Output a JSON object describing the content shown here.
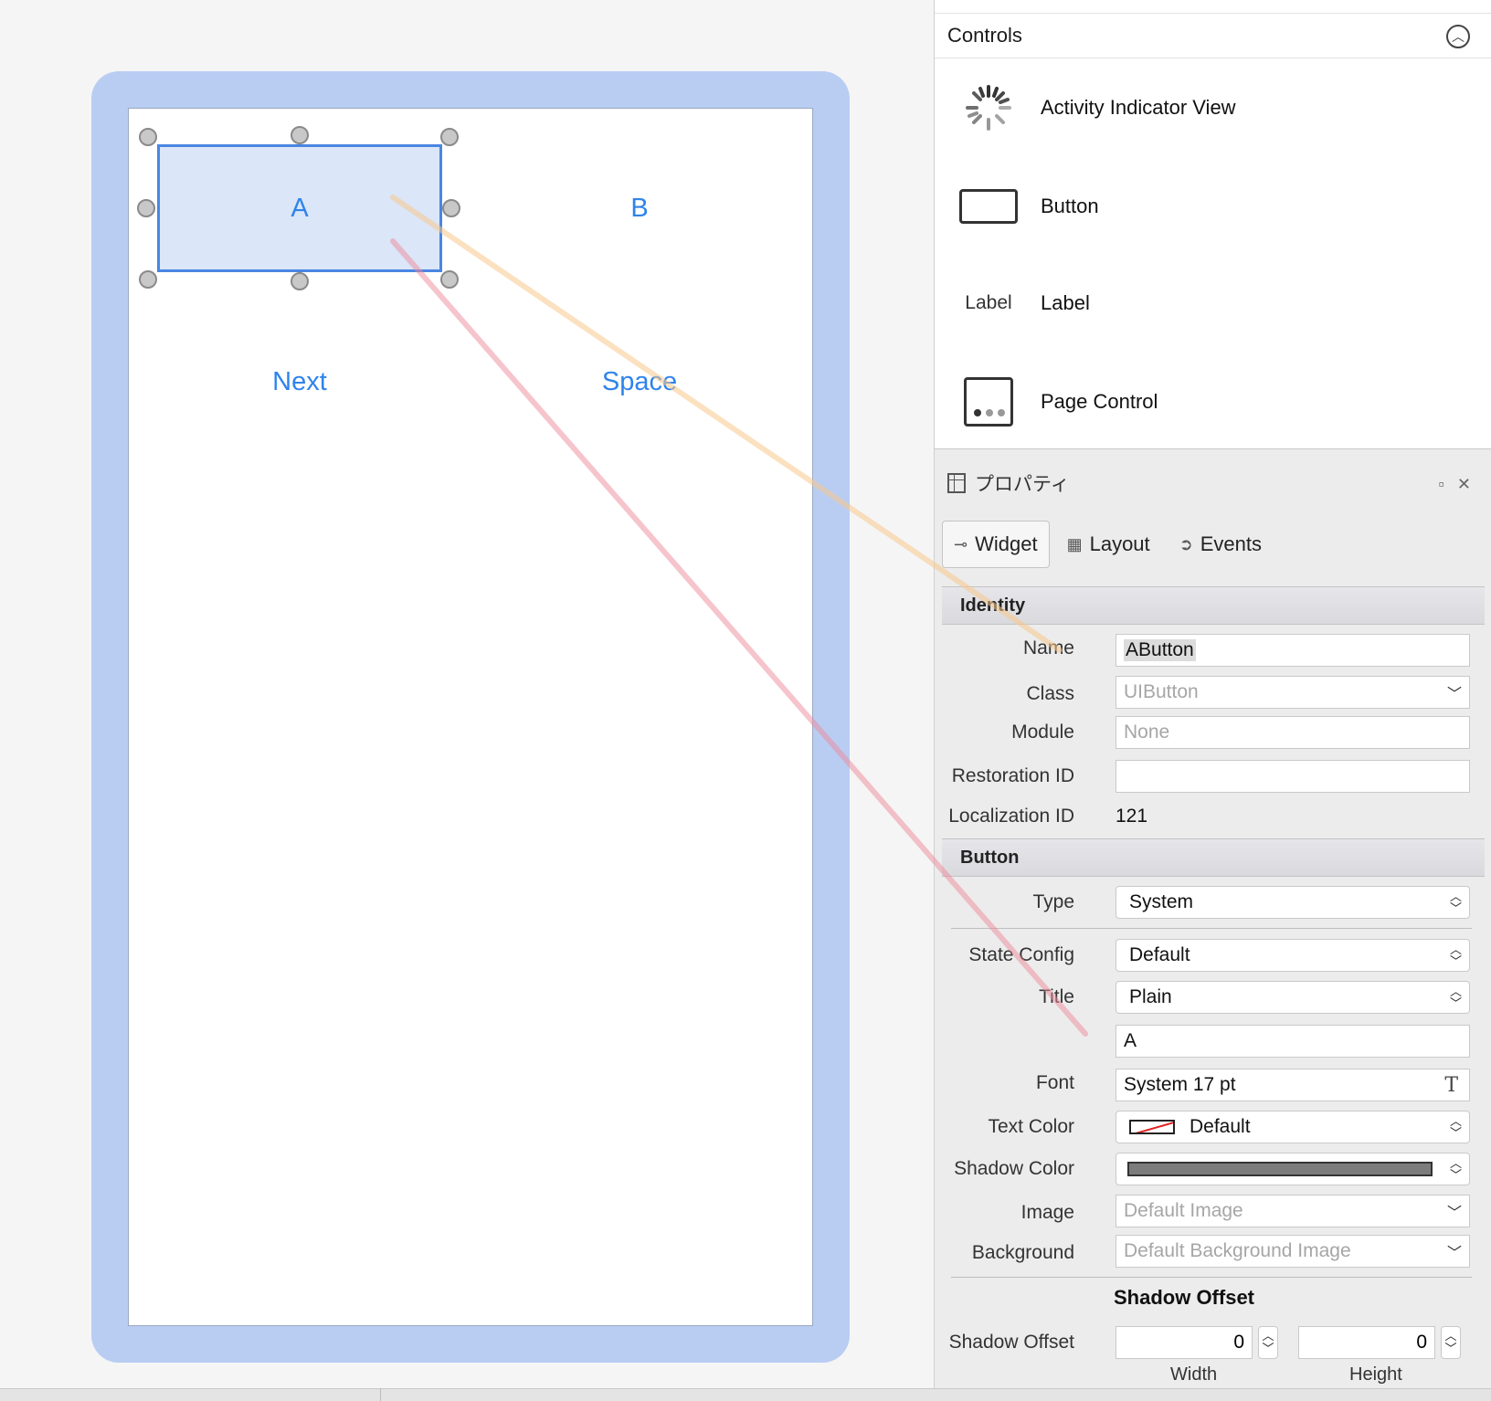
{
  "canvas": {
    "buttons": {
      "a": "A",
      "b": "B",
      "next": "Next",
      "space": "Space"
    },
    "colors": {
      "device_frame": "#b9cdf3",
      "selection": "#4a86e2",
      "button_text": "#2f84ea",
      "connector_name": "#f7c98c",
      "connector_title": "#ee8a9a"
    }
  },
  "toolbox": {
    "title": "Controls",
    "items": [
      {
        "label": "Activity Indicator View",
        "icon": "activity-indicator-icon"
      },
      {
        "label": "Button",
        "icon": "button-outline-icon"
      },
      {
        "label": "Label",
        "icon": "label-text-icon",
        "icon_text": "Label"
      },
      {
        "label": "Page Control",
        "icon": "page-control-icon"
      }
    ]
  },
  "properties": {
    "title": "プロパティ",
    "tabs": {
      "widget": "Widget",
      "layout": "Layout",
      "events": "Events"
    },
    "identity": {
      "header": "Identity",
      "name_label": "Name",
      "name_value": "AButton",
      "class_label": "Class",
      "class_placeholder": "UIButton",
      "module_label": "Module",
      "module_placeholder": "None",
      "restoration_label": "Restoration ID",
      "restoration_value": "",
      "localization_label": "Localization ID",
      "localization_value": "121"
    },
    "button": {
      "header": "Button",
      "type_label": "Type",
      "type_value": "System",
      "state_label": "State Config",
      "state_value": "Default",
      "title_label": "Title",
      "title_mode": "Plain",
      "title_text": "A",
      "font_label": "Font",
      "font_value": "System 17 pt",
      "text_color_label": "Text Color",
      "text_color_value": "Default",
      "shadow_color_label": "Shadow Color",
      "image_label": "Image",
      "image_placeholder": "Default Image",
      "background_label": "Background",
      "background_placeholder": "Default Background Image",
      "shadow_offset_heading": "Shadow Offset",
      "shadow_offset_label": "Shadow Offset",
      "shadow_width_value": "0",
      "shadow_height_value": "0",
      "width_label": "Width",
      "height_label": "Height"
    }
  }
}
